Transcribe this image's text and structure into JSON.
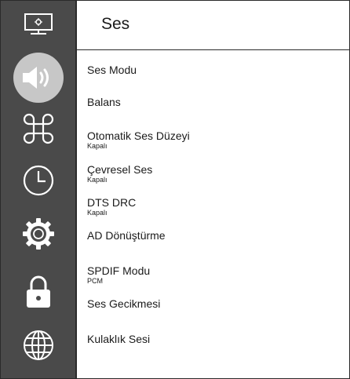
{
  "header": {
    "title": "Ses"
  },
  "sidebar": {
    "items": [
      {
        "icon": "display-icon"
      },
      {
        "icon": "speaker-icon",
        "active": true
      },
      {
        "icon": "command-icon"
      },
      {
        "icon": "clock-icon"
      },
      {
        "icon": "settings-gear-icon"
      },
      {
        "icon": "lock-icon"
      },
      {
        "icon": "globe-icon"
      }
    ]
  },
  "menu": {
    "items": [
      {
        "label": "Ses Modu",
        "sub": ""
      },
      {
        "label": "Balans",
        "sub": ""
      },
      {
        "label": "Otomatik Ses Düzeyi",
        "sub": "Kapalı"
      },
      {
        "label": "Çevresel Ses",
        "sub": "Kapalı"
      },
      {
        "label": "DTS DRC",
        "sub": "Kapalı"
      },
      {
        "label": "AD Dönüştürme",
        "sub": ""
      },
      {
        "label": "SPDIF Modu",
        "sub": "PCM"
      },
      {
        "label": "Ses Gecikmesi",
        "sub": ""
      },
      {
        "label": "Kulaklık Sesi",
        "sub": ""
      }
    ]
  },
  "colors": {
    "sidebar_bg": "#4a4a4a",
    "active_highlight": "#c7c7c7",
    "icon": "#ffffff",
    "text": "#1a1a1a"
  }
}
